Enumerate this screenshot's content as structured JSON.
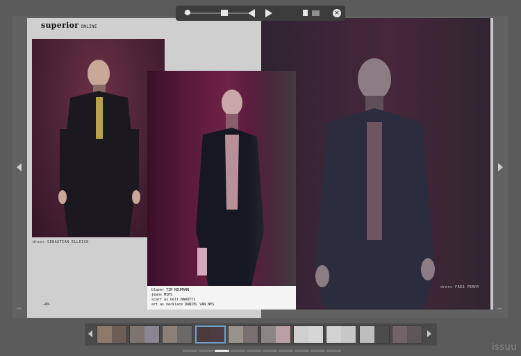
{
  "magazine": {
    "logo": "superior",
    "logo_suffix": "ONLINE",
    "left_caption": "dress SEBASTIAN ELLRICH",
    "page_number": "-40-",
    "card_caption": [
      "blazer TIM NEUMANN",
      "jeans MIPS",
      "scarf as belt BARUTTI",
      "art as necklace DANIEL VAN NES"
    ],
    "right_caption": "dress FRED PERRY"
  },
  "toolbar": {
    "zoom_level": 0.05,
    "icons": [
      "slider-knob",
      "grid-icon",
      "previous-icon",
      "next-icon",
      "single-page-icon",
      "spread-icon",
      "close-icon"
    ]
  },
  "thumbnails": {
    "count": 10,
    "active_index": 3,
    "colors": [
      [
        "#8c7b6a",
        "#6e5d55"
      ],
      [
        "#7d7470",
        "#8a8690"
      ],
      [
        "#8c7f75",
        "#6b6868"
      ],
      [
        "#4c3a3e",
        "#4d3c44"
      ],
      [
        "#9a938c",
        "#7a6f70"
      ],
      [
        "#8c8585",
        "#b9a1a3"
      ],
      [
        "#cfcfcf",
        "#d6d6d6"
      ],
      [
        "#d2d2d2",
        "#c7c7c7"
      ],
      [
        "#bdbdbd",
        "#4c4c4c"
      ],
      [
        "#726466",
        "#5e5658"
      ]
    ]
  },
  "pager": {
    "segments": 10,
    "active": 2
  },
  "brand": "issuu"
}
